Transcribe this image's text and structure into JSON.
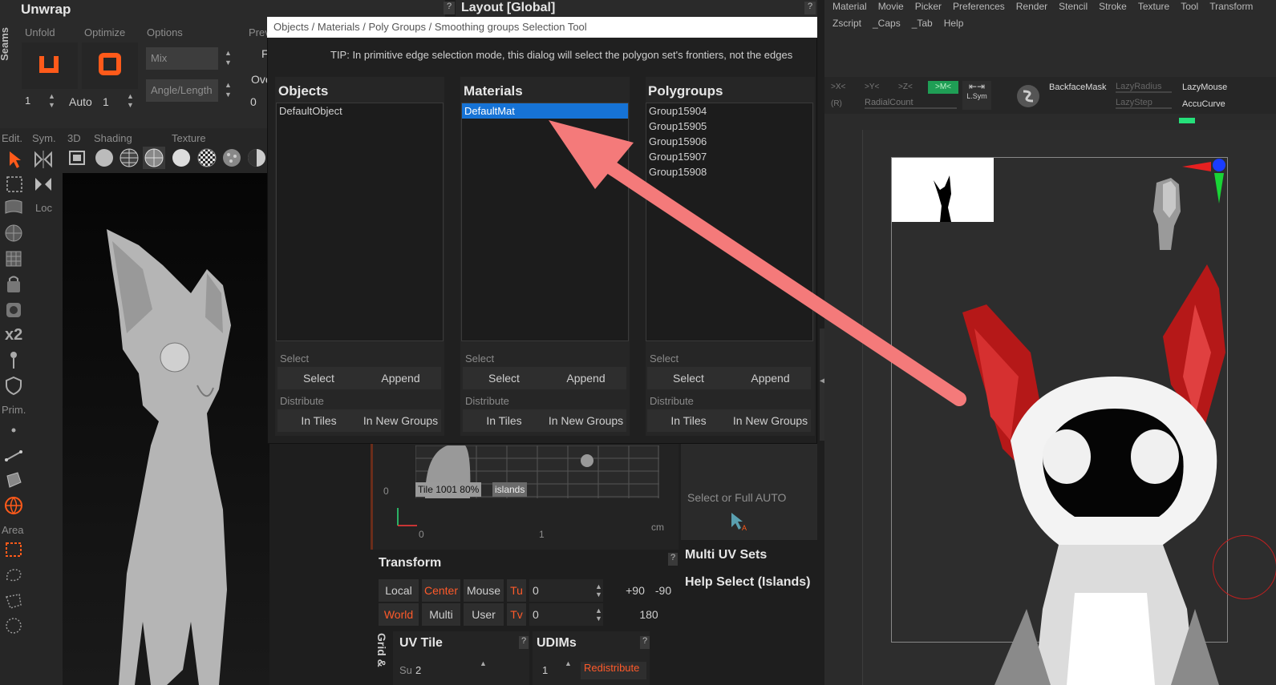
{
  "unwrap": {
    "title": "Unwrap",
    "seams_label": "Seams",
    "tabs": [
      "Unfold",
      "Optimize",
      "Options",
      "Prev"
    ],
    "mix_value": "Mix",
    "angle_value": "Angle/Length",
    "unfold_num": "1",
    "auto_label": "Auto",
    "auto_num": "1",
    "opt_zero": "0",
    "opt_f": "F",
    "opt_ov": "Ove"
  },
  "layout_title": "Layout [Global]",
  "left_toolbar": {
    "labels": [
      "Edit.",
      "Sym.",
      "Loc",
      "x2",
      "Prim.",
      "Area"
    ]
  },
  "shading_bar": {
    "label_3d": "3D",
    "label_shading": "Shading",
    "label_texture": "Texture"
  },
  "dialog": {
    "title": "Objects / Materials / Poly Groups / Smoothing groups Selection Tool",
    "tip": "TIP: In primitive edge selection mode, this dialog will select the polygon set's frontiers, not the edges",
    "columns": [
      {
        "header": "Objects",
        "items": [
          "DefaultObject"
        ],
        "select_label": "Select",
        "select_btn": "Select",
        "append_btn": "Append",
        "distribute_label": "Distribute",
        "in_tiles_btn": "In Tiles",
        "in_new_groups_btn": "In New Groups"
      },
      {
        "header": "Materials",
        "items": [
          "DefaultMat"
        ],
        "select_label": "Select",
        "select_btn": "Select",
        "append_btn": "Append",
        "distribute_label": "Distribute",
        "in_tiles_btn": "In Tiles",
        "in_new_groups_btn": "In New Groups"
      },
      {
        "header": "Polygroups",
        "items": [
          "Group15904",
          "Group15905",
          "Group15906",
          "Group15907",
          "Group15908"
        ],
        "select_label": "Select",
        "select_btn": "Select",
        "append_btn": "Append",
        "distribute_label": "Distribute",
        "in_tiles_btn": "In Tiles",
        "in_new_groups_btn": "In New Groups"
      }
    ]
  },
  "uv_panel": {
    "tile_label": "Tile",
    "tile_num": "1001",
    "tile_pct": "80%",
    "islands_label": "islands",
    "zero_left": "0",
    "axis_0": "0",
    "axis_1": "1",
    "axis_unit": "cm",
    "select_auto": "Select or Full AUTO",
    "multi_uv_sets": "Multi UV Sets",
    "help_select": "Help Select (Islands)"
  },
  "transform": {
    "title": "Transform",
    "local": "Local",
    "center": "Center",
    "mouse": "Mouse",
    "tu": "Tu",
    "tu_val": "0",
    "plus90": "+90",
    "minus90": "-90",
    "world": "World",
    "multi": "Multi",
    "user": "User",
    "tv": "Tv",
    "tv_val": "0",
    "val180": "180"
  },
  "uv_tile": {
    "title": "UV Tile",
    "su_label": "Su",
    "su_val": "2",
    "grid_label": "Grid &"
  },
  "udims": {
    "title": "UDIMs",
    "num": "1",
    "redistribute": "Redistribute"
  },
  "right_app": {
    "menu_row1": [
      "Material",
      "Movie",
      "Picker",
      "Preferences",
      "Render",
      "Stencil",
      "Stroke",
      "Texture",
      "Tool",
      "Transform"
    ],
    "menu_row2": [
      "Zscript",
      "_Caps",
      "_Tab",
      "Help"
    ],
    "sym_x": ">X<",
    "sym_y": ">Y<",
    "sym_z": ">Z<",
    "sym_m": ">M<",
    "sym_r": "(R)",
    "radial_count": "RadialCount",
    "lsym": "L.Sym",
    "backface_mask": "BackfaceMask",
    "lazy_radius": "LazyRadius",
    "lazy_step": "LazyStep",
    "lazy_mouse": "LazyMouse",
    "accu_curve": "AccuCurve"
  },
  "colors": {
    "accent_orange": "#ff5a2a",
    "selection_blue": "#1673d6",
    "arrow_pink": "#f47a7a",
    "sym_green": "#1f9e55"
  }
}
